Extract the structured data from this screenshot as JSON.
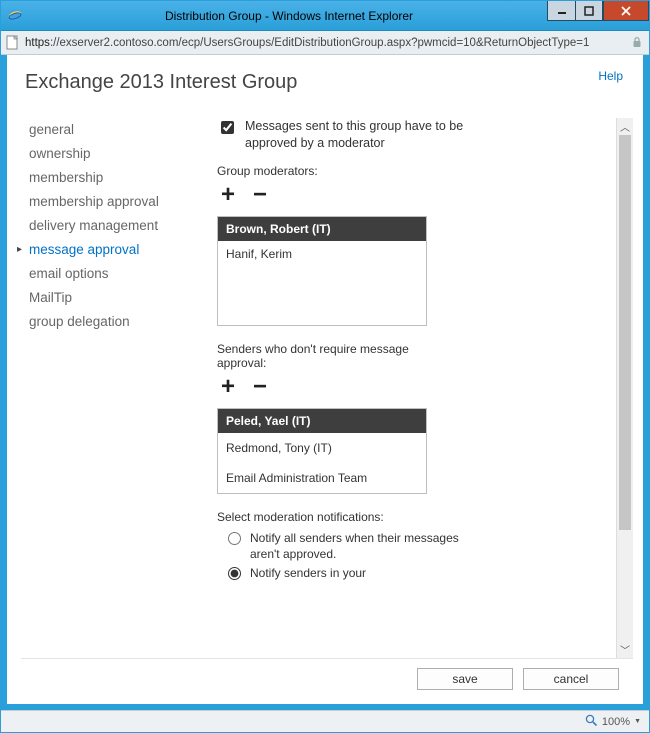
{
  "window": {
    "title": "Distribution Group - Windows Internet Explorer",
    "url_scheme": "https",
    "url_rest": "://exserver2.contoso.com/ecp/UsersGroups/EditDistributionGroup.aspx?pwmcid=10&ReturnObjectType=1"
  },
  "page": {
    "help": "Help",
    "title": "Exchange 2013 Interest Group"
  },
  "nav": {
    "items": [
      {
        "label": "general"
      },
      {
        "label": "ownership"
      },
      {
        "label": "membership"
      },
      {
        "label": "membership approval"
      },
      {
        "label": "delivery management"
      },
      {
        "label": "message approval",
        "active": true
      },
      {
        "label": "email options"
      },
      {
        "label": "MailTip"
      },
      {
        "label": "group delegation"
      }
    ]
  },
  "form": {
    "moderated_checkbox_label": "Messages sent to this group have to be approved by a moderator",
    "moderated_checked": true,
    "moderators_label": "Group moderators:",
    "moderators": {
      "header": "Brown, Robert (IT)",
      "rows": [
        "Hanif, Kerim"
      ]
    },
    "bypass_label": "Senders who don't require message approval:",
    "bypass": {
      "header": "Peled, Yael (IT)",
      "rows": [
        "Redmond, Tony (IT)",
        "Email Administration Team"
      ]
    },
    "notifications_label": "Select moderation notifications:",
    "radio1": "Notify all senders when their messages aren't approved.",
    "radio2": "Notify senders in your",
    "selected_radio": 2
  },
  "buttons": {
    "save": "save",
    "cancel": "cancel"
  },
  "status": {
    "zoom": "100%"
  },
  "icons": {
    "plus": "+",
    "minus": "−"
  }
}
